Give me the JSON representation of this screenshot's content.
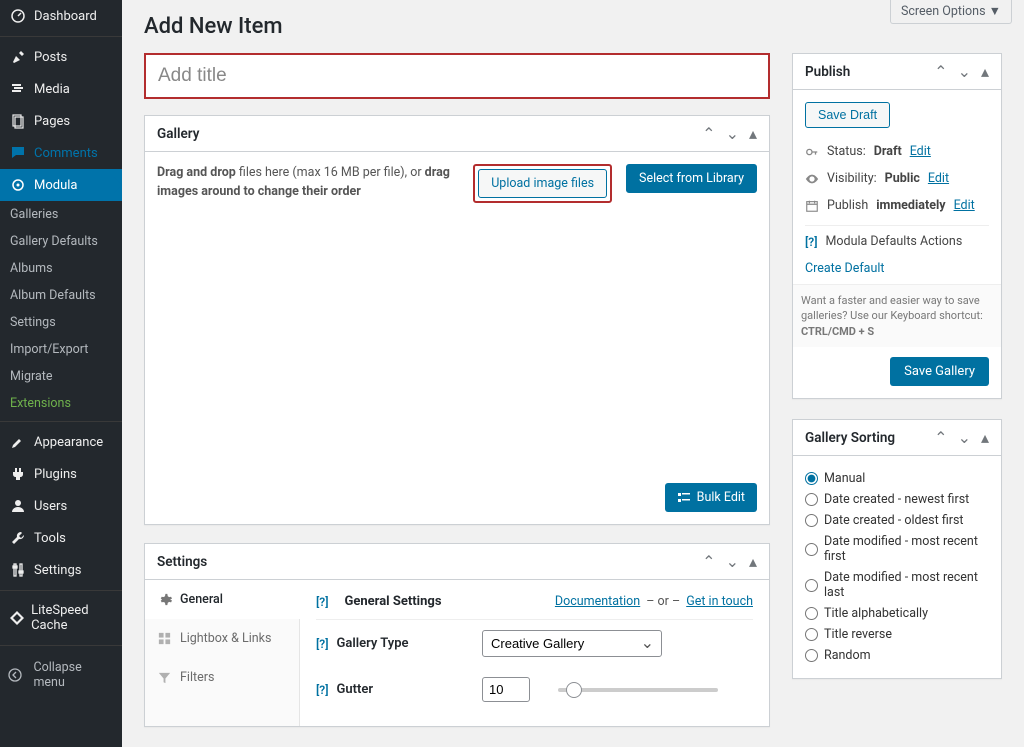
{
  "screen_options": "Screen Options ▼",
  "page_title": "Add New Item",
  "title_placeholder": "Add title",
  "sidebar": {
    "items": [
      {
        "label": "Dashboard",
        "icon": "dashboard"
      },
      {
        "label": "Posts",
        "icon": "pin"
      },
      {
        "label": "Media",
        "icon": "media"
      },
      {
        "label": "Pages",
        "icon": "page"
      },
      {
        "label": "Comments",
        "icon": "comment"
      },
      {
        "label": "Modula",
        "icon": "modula"
      }
    ],
    "sub_items": [
      "Galleries",
      "Gallery Defaults",
      "Albums",
      "Album Defaults",
      "Settings",
      "Import/Export",
      "Migrate",
      "Extensions"
    ],
    "lower": [
      {
        "label": "Appearance",
        "icon": "brush"
      },
      {
        "label": "Plugins",
        "icon": "plug"
      },
      {
        "label": "Users",
        "icon": "user"
      },
      {
        "label": "Tools",
        "icon": "tool"
      },
      {
        "label": "Settings",
        "icon": "gear"
      },
      {
        "label": "LiteSpeed Cache",
        "icon": "cache"
      }
    ],
    "collapse": "Collapse menu"
  },
  "gallery": {
    "title": "Gallery",
    "drag_prefix": "Drag and drop",
    "drag_mid": " files here (max 16 MB per file), or ",
    "drag_bold2": "drag images around to change their order",
    "upload_btn": "Upload image files",
    "library_btn": "Select from Library",
    "bulk_edit": "Bulk Edit"
  },
  "settings_panel": {
    "title": "Settings",
    "tabs": [
      "General",
      "Lightbox & Links",
      "Filters"
    ],
    "heading": "General Settings",
    "doc": "Documentation",
    "or": "– or –",
    "contact": "Get in touch",
    "gallery_type_label": "Gallery Type",
    "gallery_type_value": "Creative Gallery",
    "gutter_label": "Gutter",
    "gutter_value": "10"
  },
  "publish": {
    "title": "Publish",
    "save_draft": "Save Draft",
    "status_label": "Status:",
    "status_value": "Draft",
    "visibility_label": "Visibility:",
    "visibility_value": "Public",
    "schedule_label": "Publish",
    "schedule_value": "immediately",
    "edit": "Edit",
    "actions_label": "Modula Defaults Actions",
    "create_default": "Create Default",
    "tip_text": "Want a faster and easier way to save galleries? Use our Keyboard shortcut: ",
    "tip_kbd": "CTRL/CMD + S",
    "save_gallery": "Save Gallery"
  },
  "sorting": {
    "title": "Gallery Sorting",
    "options": [
      "Manual",
      "Date created - newest first",
      "Date created - oldest first",
      "Date modified - most recent first",
      "Date modified - most recent last",
      "Title alphabetically",
      "Title reverse",
      "Random"
    ],
    "selected": 0
  },
  "help_icon": "[?]"
}
